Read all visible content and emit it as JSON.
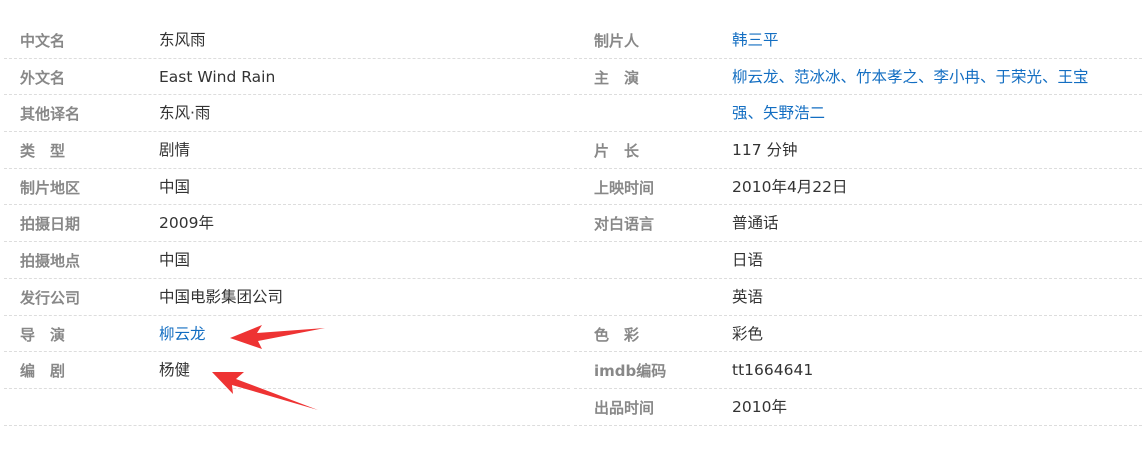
{
  "left_rows": [
    {
      "label": "中文名",
      "value": "东风雨"
    },
    {
      "label": "外文名",
      "value": "East Wind Rain"
    },
    {
      "label": "其他译名",
      "value": "东风·雨"
    },
    {
      "label": "类　型",
      "value": "剧情"
    },
    {
      "label": "制片地区",
      "value": "中国"
    },
    {
      "label": "拍摄日期",
      "value": "2009年"
    },
    {
      "label": "拍摄地点",
      "value": "中国"
    },
    {
      "label": "发行公司",
      "value": "中国电影集团公司"
    },
    {
      "label": "导　演",
      "value": "柳云龙"
    },
    {
      "label": "编　剧",
      "value": "杨健"
    },
    {
      "label": "",
      "value": ""
    }
  ],
  "right_rows": [
    {
      "label": "制片人",
      "value": "韩三平"
    },
    {
      "label": "主　演",
      "value": "柳云龙、范冰冰、竹本孝之、李小冉、于荣光、王宝"
    },
    {
      "label": "",
      "value": "强、矢野浩二"
    },
    {
      "label": "片　长",
      "value": "117 分钟"
    },
    {
      "label": "上映时间",
      "value": "2010年4月22日"
    },
    {
      "label": "对白语言",
      "value": "普通话"
    },
    {
      "label": "",
      "value": "日语"
    },
    {
      "label": "",
      "value": "英语"
    },
    {
      "label": "色　彩",
      "value": "彩色"
    },
    {
      "label": "imdb编码",
      "value": "tt1664641"
    },
    {
      "label": "出品时间",
      "value": "2010年"
    }
  ],
  "colors": {
    "label": "#888888",
    "text": "#333333",
    "link": "#136ec2",
    "arrow": "#ee3333",
    "divider": "#dddddd"
  },
  "annotations": [
    {
      "name": "red-arrow",
      "points_to": "导演"
    },
    {
      "name": "red-arrow",
      "points_to": "编剧"
    }
  ]
}
